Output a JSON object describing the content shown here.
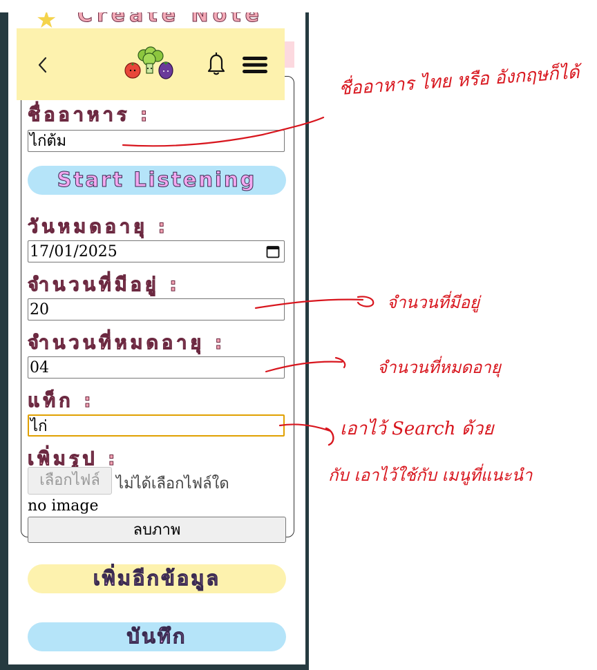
{
  "header": {
    "title": "Create Note",
    "back_icon": "chevron-left-icon",
    "logo": "vegetables-logo",
    "bell_icon": "bell-icon",
    "menu_icon": "hamburger-menu-icon"
  },
  "form": {
    "food_name_label": "ชื่ออาหาร :",
    "food_name_value": "ไก่ต้ม",
    "listen_button": "Start Listening",
    "expiry_label": "วันหมดอายุ :",
    "expiry_value": "17/01/2025",
    "quantity_label": "จำนวนที่มีอยู่ :",
    "quantity_value": "20",
    "expired_qty_label": "จำนวนที่หมดอายุ :",
    "expired_qty_value": "04",
    "tag_label": "แท็ก :",
    "tag_value": "ไก่",
    "image_label": "เพิ่มรูป :",
    "file_button": "เลือกไฟล์",
    "file_status": "ไม่ได้เลือกไฟล์ใด",
    "no_image": "no image",
    "delete_image_button": "ลบภาพ"
  },
  "buttons": {
    "add_more": "เพิ่มอีกข้อมูล",
    "save": "บันทึก"
  },
  "annotations": {
    "food_name_note": "ชื่ออาหาร ไทย หรือ อังกฤษก็ได้",
    "quantity_note": "จำนวนที่มีอยู่",
    "expired_note": "จำนวนที่หมดอายุ",
    "tag_note_1": "เอาไว้ Search ด้วย",
    "tag_note_2": "กับ เอาไว้ใช้กับ เมนูที่แนะนำ"
  },
  "colors": {
    "header_bg": "#fdf2ae",
    "blue_button": "#b5e4f9",
    "label_pink": "#f2a3b3",
    "annotation_red": "#d8161e",
    "frame": "#263a40"
  }
}
